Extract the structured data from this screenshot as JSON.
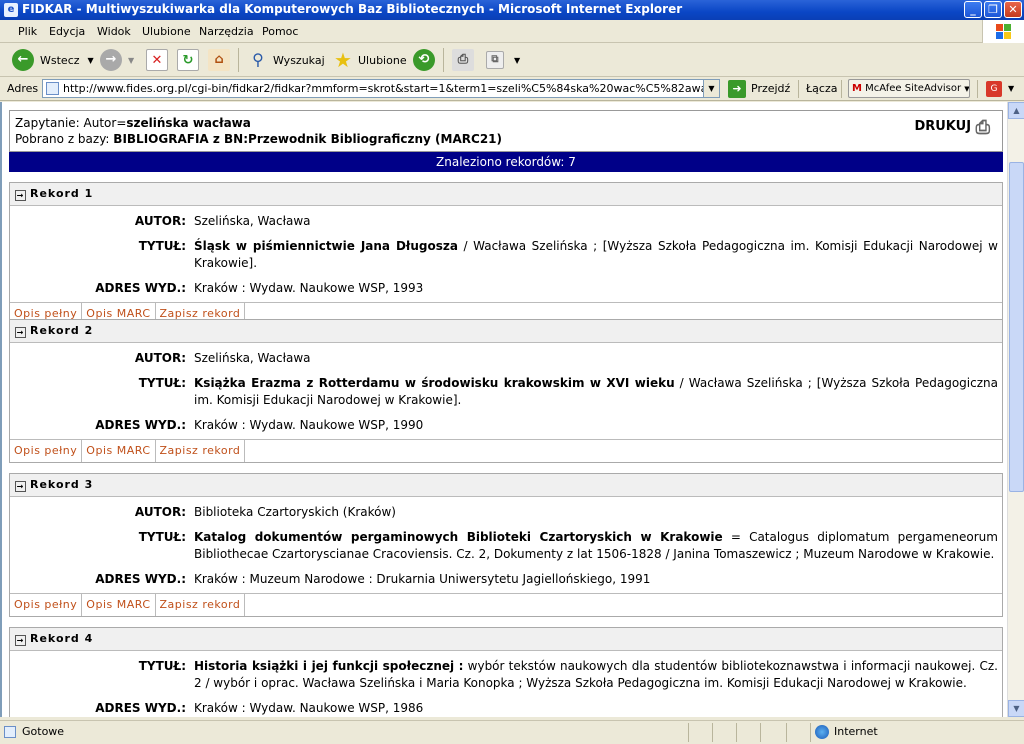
{
  "window": {
    "title": "FIDKAR - Multiwyszukiwarka dla Komputerowych Baz Bibliotecznych - Microsoft Internet Explorer"
  },
  "menu": [
    "Plik",
    "Edycja",
    "Widok",
    "Ulubione",
    "Narzędzia",
    "Pomoc"
  ],
  "toolbar": {
    "back": "Wstecz",
    "search": "Wyszukaj",
    "favorites": "Ulubione"
  },
  "address": {
    "label": "Adres",
    "url": "http://www.fides.org.pl/cgi-bin/fidkar2/fidkar?mmform=skrot&start=1&term1=szeli%C5%84ska%20wac%C5%82awa&term2=&te",
    "go": "Przejdź",
    "links": "Łącza",
    "mcafee": "McAfee SiteAdvisor"
  },
  "query": {
    "label": "Zapytanie: Autor=",
    "value": "szelińska wacława",
    "db_label": "Pobrano z bazy: ",
    "db_value": "BIBLIOGRAFIA z BN:Przewodnik Bibliograficzny (MARC21)",
    "print": "DRUKUJ"
  },
  "found": "Znaleziono rekordów: 7",
  "labels": {
    "autor": "AUTOR:",
    "tytul": "TYTUŁ:",
    "adres": "ADRES WYD.:"
  },
  "actions": [
    "Opis pełny",
    "Opis MARC",
    "Zapisz rekord"
  ],
  "records": [
    {
      "header": "Rekord 1",
      "autor": "Szelińska, Wacława",
      "title_bold": "Śląsk w piśmiennictwie Jana Długosza",
      "title_rest": " / Wacława Szelińska ; [Wyższa Szkoła Pedagogiczna im. Komisji Edukacji Narodowej w Krakowie].",
      "adres": "Kraków : Wydaw. Naukowe WSP, 1993"
    },
    {
      "header": "Rekord 2",
      "autor": "Szelińska, Wacława",
      "title_bold": "Książka Erazma z Rotterdamu w środowisku krakowskim w XVI wieku",
      "title_rest": " / Wacława Szelińska ; [Wyższa Szkoła Pedagogiczna im. Komisji Edukacji Narodowej w Krakowie].",
      "adres": "Kraków : Wydaw. Naukowe WSP, 1990"
    },
    {
      "header": "Rekord 3",
      "autor": "Biblioteka Czartoryskich (Kraków)",
      "title_bold": "Katalog dokumentów pergaminowych Biblioteki Czartoryskich w Krakowie",
      "title_rest": " = Catalogus diplomatum pergameneorum Bibliothecae Czartoryscianae Cracoviensis. Cz. 2, Dokumenty z lat 1506-1828 / Janina Tomaszewicz ; Muzeum Narodowe w Krakowie.",
      "adres": "Kraków : Muzeum Narodowe : Drukarnia Uniwersytetu Jagiellońskiego, 1991"
    },
    {
      "header": "Rekord 4",
      "title_bold": "Historia książki i jej funkcji społecznej :",
      "title_rest": " wybór tekstów naukowych dla studentów bibliotekoznawstwa i informacji naukowej. Cz. 2 / wybór i oprac. Wacława Szelińska i Maria Konopka ; Wyższa Szkoła Pedagogiczna im. Komisji Edukacji Narodowej w Krakowie.",
      "adres": "Kraków : Wydaw. Naukowe WSP, 1986"
    }
  ],
  "status": {
    "left": "Gotowe",
    "zone": "Internet"
  }
}
